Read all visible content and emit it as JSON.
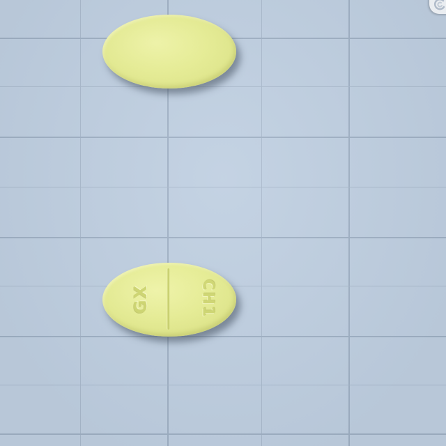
{
  "scene": {
    "background_color": "#bfcfe1",
    "grid_color": "#a9b9cc",
    "tablet_color": "#e8ef94"
  },
  "tablets": [
    {
      "side": "front",
      "imprint": []
    },
    {
      "side": "back",
      "imprint": [
        "GX",
        "CH1"
      ],
      "scored": true
    }
  ],
  "corner_badge": {
    "icon": "swirl-logo-icon"
  }
}
